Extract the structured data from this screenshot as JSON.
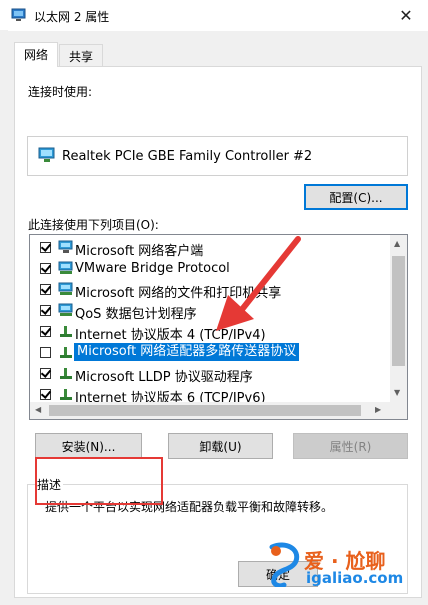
{
  "window": {
    "title": "以太网 2 属性",
    "close_glyph": "✕"
  },
  "tabs": [
    {
      "label": "网络",
      "active": true
    },
    {
      "label": "共享",
      "active": false
    }
  ],
  "connect_using": {
    "label": "连接时使用:",
    "adapter": "Realtek PCIe GBE Family Controller #2"
  },
  "configure_button": "配置(C)...",
  "items_label": "此连接使用下列项目(O):",
  "items": [
    {
      "label": "Microsoft 网络客户端",
      "checked": true,
      "icon": "network-client-icon"
    },
    {
      "label": "VMware Bridge Protocol",
      "checked": true,
      "icon": "network-service-icon"
    },
    {
      "label": "Microsoft 网络的文件和打印机共享",
      "checked": true,
      "icon": "network-service-icon"
    },
    {
      "label": "QoS 数据包计划程序",
      "checked": true,
      "icon": "network-service-icon"
    },
    {
      "label": "Internet 协议版本 4 (TCP/IPv4)",
      "checked": true,
      "icon": "protocol-icon"
    },
    {
      "label": "Microsoft 网络适配器多路传送器协议",
      "checked": false,
      "icon": "protocol-icon",
      "selected": true
    },
    {
      "label": "Microsoft LLDP 协议驱动程序",
      "checked": true,
      "icon": "protocol-icon"
    },
    {
      "label": "Internet 协议版本 6 (TCP/IPv6)",
      "checked": true,
      "icon": "protocol-icon"
    }
  ],
  "buttons": {
    "install": "安装(N)...",
    "uninstall": "卸载(U)",
    "properties": "属性(R)",
    "ok": "确定"
  },
  "description": {
    "title": "描述",
    "text": "提供一个平台以实现网络适配器负载平衡和故障转移。"
  },
  "watermark": {
    "brand": "爱 · 尬聊",
    "site": "igaliao.com"
  },
  "colors": {
    "accent": "#0078d7",
    "annotation": "#e53935"
  }
}
